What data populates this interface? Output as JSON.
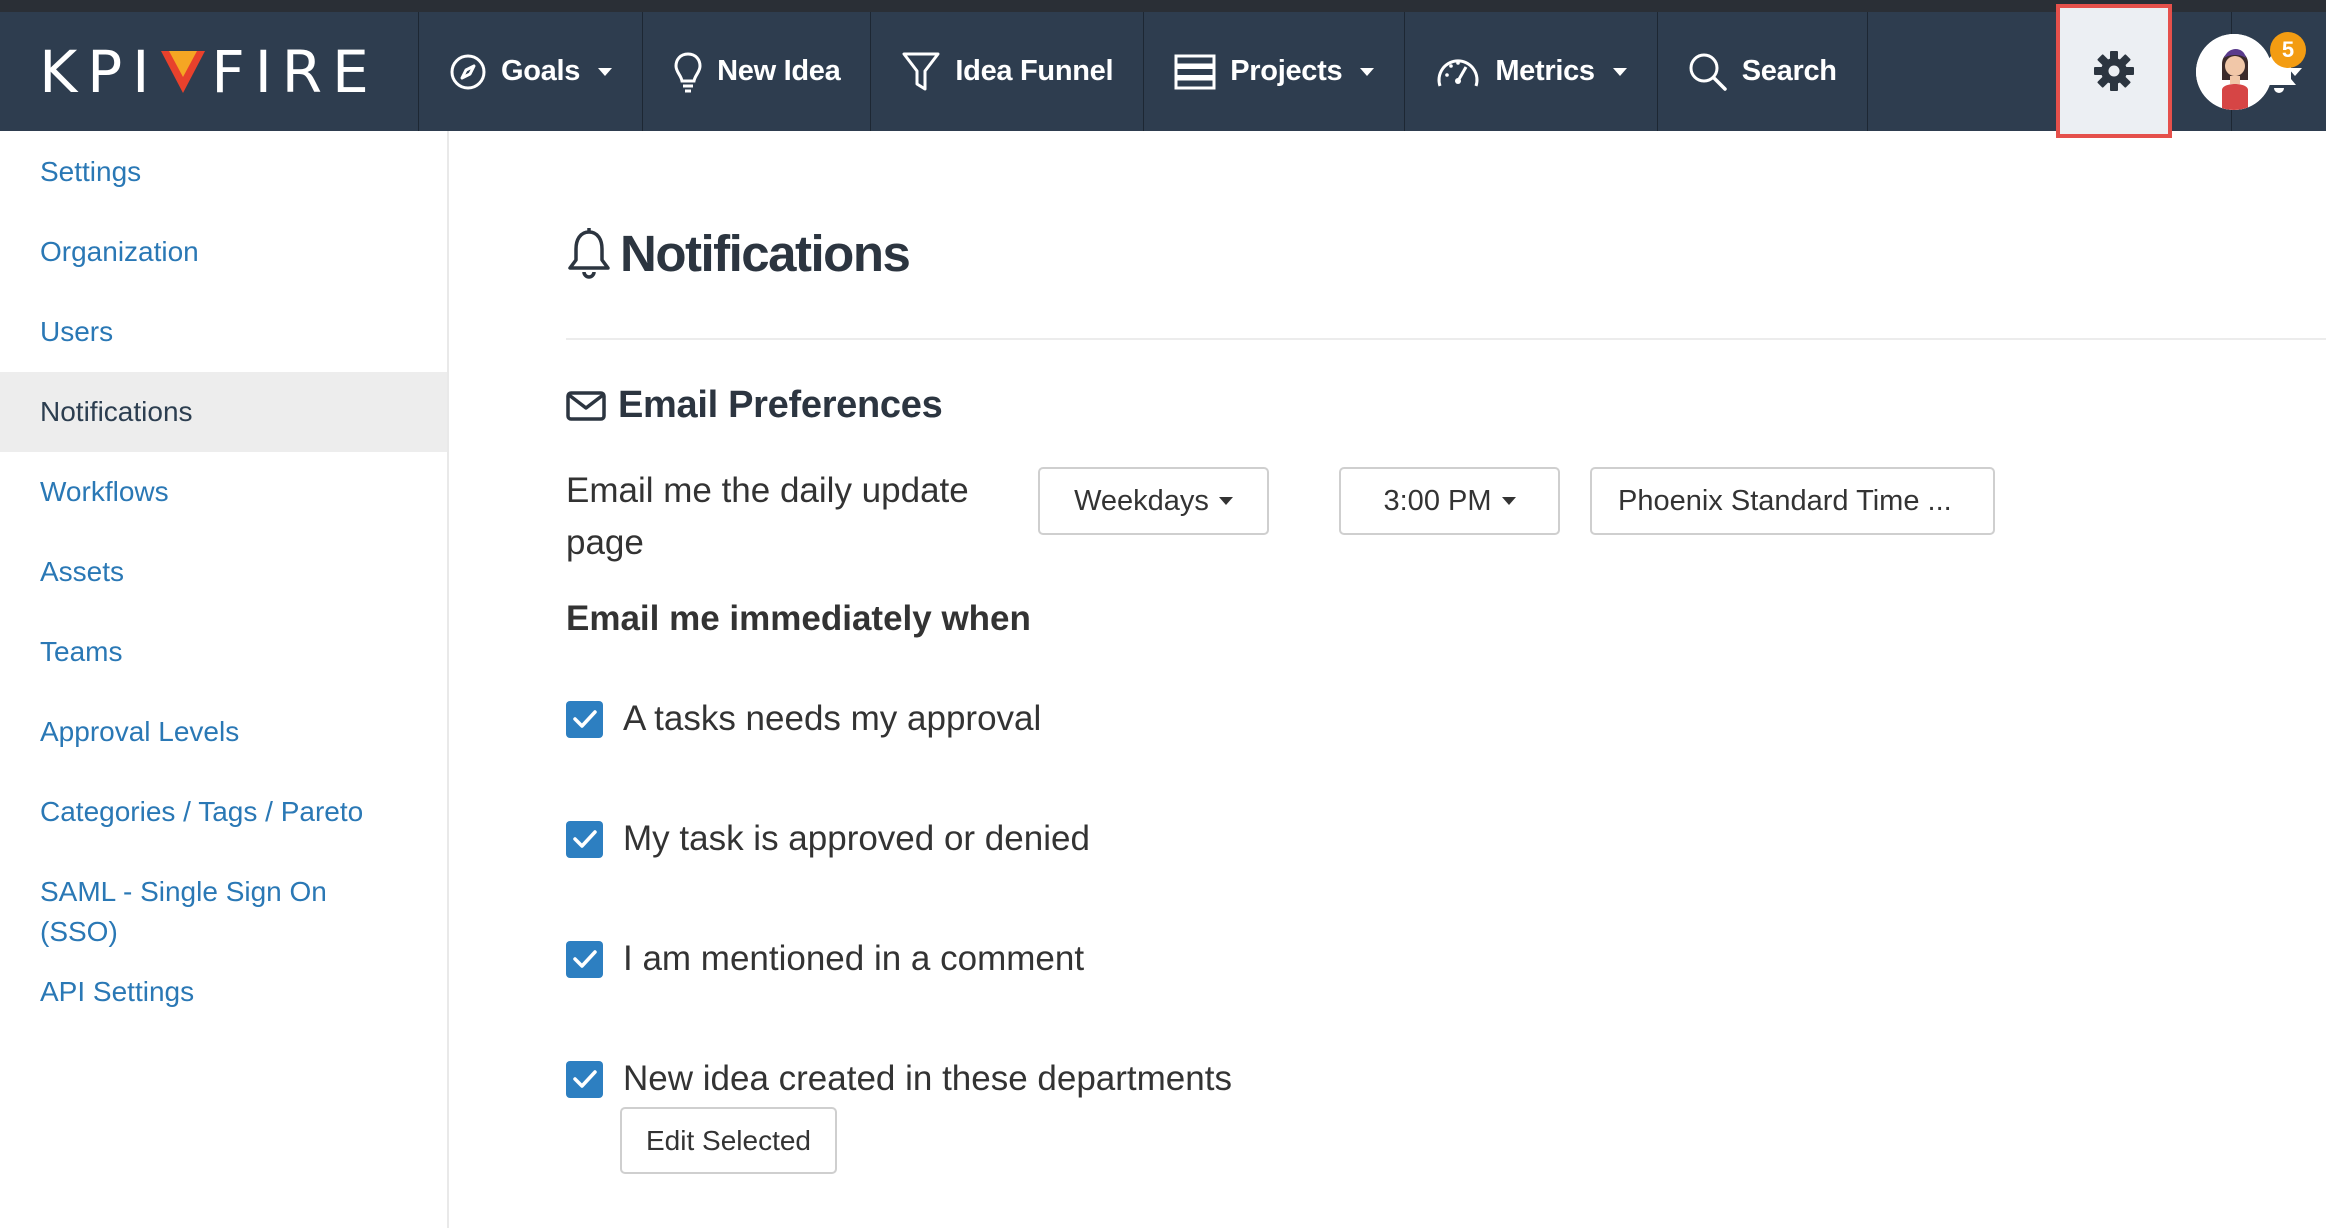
{
  "brand": {
    "logo_left": "KPI",
    "logo_right": "FIRE"
  },
  "nav": {
    "goals": "Goals",
    "new_idea": "New Idea",
    "idea_funnel": "Idea Funnel",
    "projects": "Projects",
    "metrics": "Metrics",
    "search": "Search",
    "notification_count": "5"
  },
  "sidebar": {
    "items": [
      {
        "label": "Settings"
      },
      {
        "label": "Organization"
      },
      {
        "label": "Users"
      },
      {
        "label": "Notifications",
        "active": true
      },
      {
        "label": "Workflows"
      },
      {
        "label": "Assets"
      },
      {
        "label": "Teams"
      },
      {
        "label": "Approval Levels"
      },
      {
        "label": "Categories / Tags / Pareto"
      },
      {
        "label": "SAML - Single Sign On (SSO)"
      },
      {
        "label": "API Settings"
      }
    ]
  },
  "page": {
    "title": "Notifications",
    "section_title": "Email Preferences",
    "daily_label": "Email me the daily update page",
    "days_value": "Weekdays",
    "time_value": "3:00 PM",
    "timezone_value": "Phoenix Standard Time ...",
    "immediate_heading": "Email me immediately when",
    "checks": [
      {
        "label": "A tasks needs my approval",
        "checked": true
      },
      {
        "label": "My task is approved or denied",
        "checked": true
      },
      {
        "label": "I am mentioned in a comment",
        "checked": true
      },
      {
        "label": "New idea created in these departments",
        "checked": true
      }
    ],
    "edit_button": "Edit Selected"
  },
  "colors": {
    "navbar": "#2e3d4f",
    "link": "#2a78b5",
    "checkbox": "#2d7fc1",
    "badge": "#f39c12",
    "highlight": "#e5504b"
  }
}
